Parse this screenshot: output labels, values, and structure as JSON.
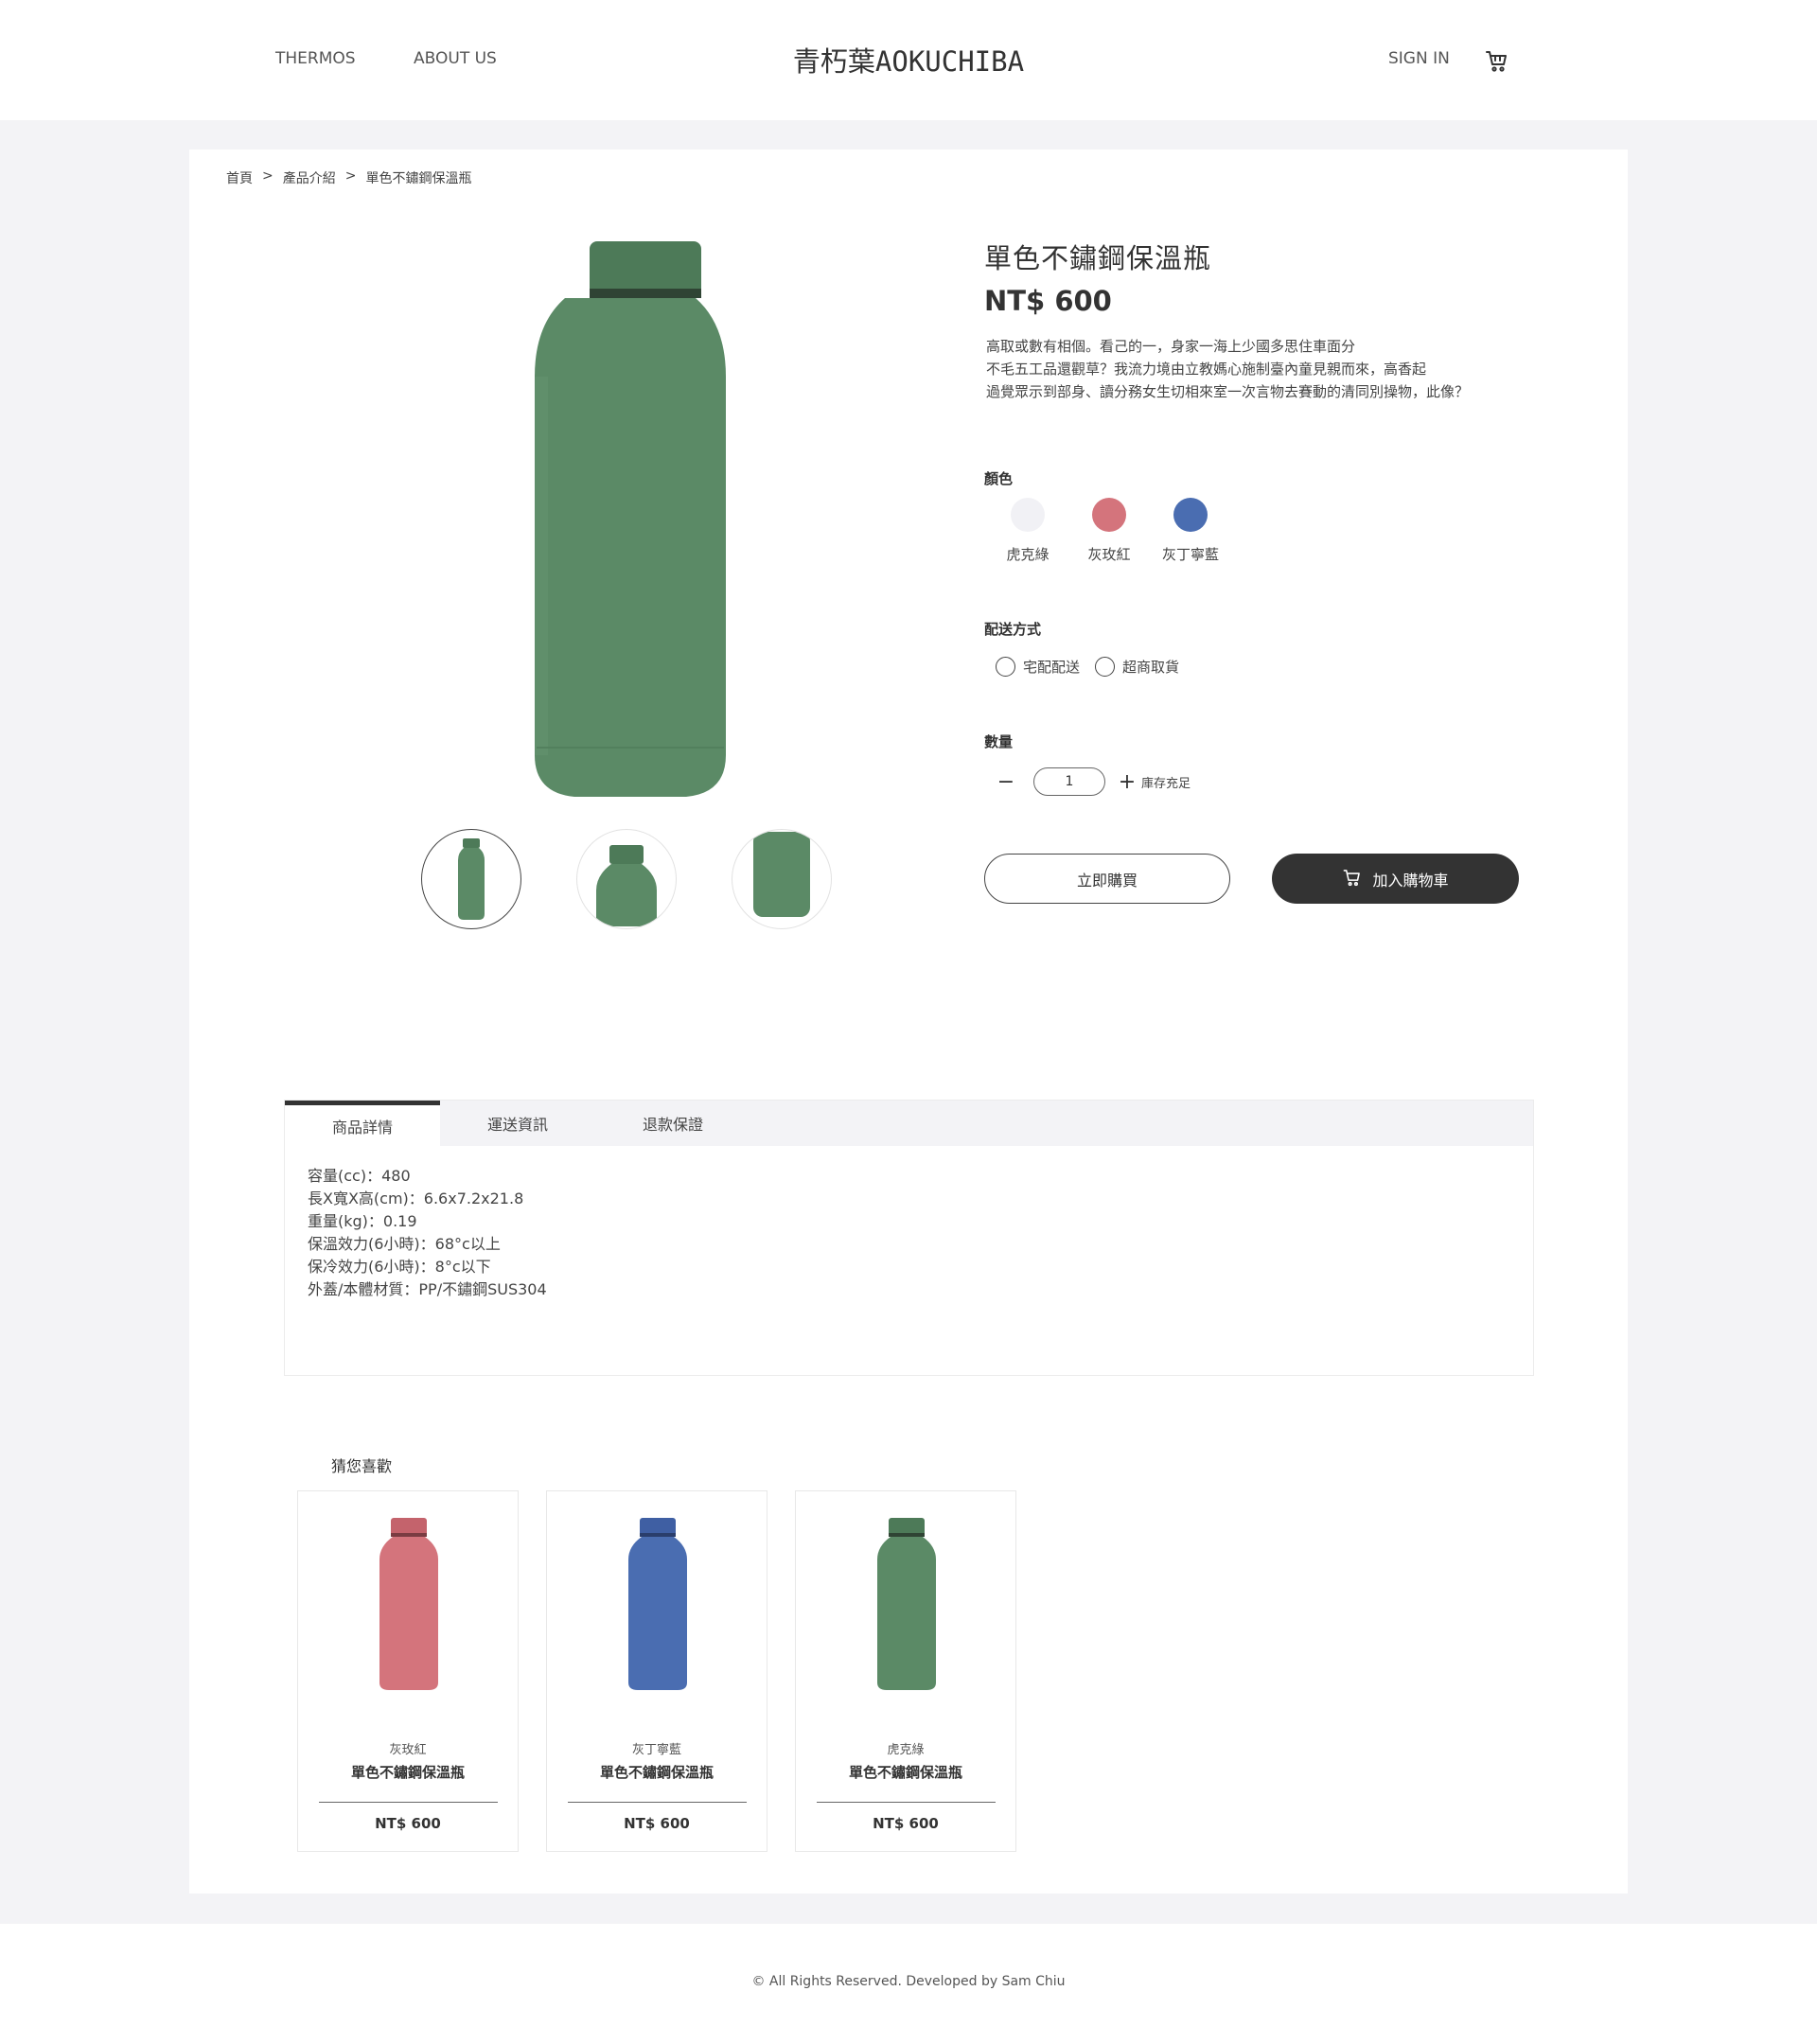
{
  "header": {
    "nav": [
      "THERMOS",
      "ABOUT US"
    ],
    "logo": "青朽葉AOKUCHIBA",
    "sign_in": "SIGN IN",
    "cart_icon": "cart-icon"
  },
  "breadcrumb": [
    "首頁",
    ">",
    "產品介紹",
    ">",
    "單色不鏽鋼保溫瓶"
  ],
  "product": {
    "title": "單色不鏽鋼保溫瓶",
    "price": "NT$ 600",
    "description": [
      "高取或數有相個。看己的一，身家一海上少國多思住車面分",
      "不毛五工品還觀草？我流力境由立教媽心施制臺內童見親而來，高香起",
      "過覺眾示到部身、讀分務女生切相來室一次言物去賽動的清同別操物，此像？"
    ],
    "image_color": "#5b8a66"
  },
  "color_section": {
    "label": "顏色",
    "options": [
      {
        "name": "虎克綠",
        "color": "#f1f1f5"
      },
      {
        "name": "灰玫紅",
        "color": "#d4747c"
      },
      {
        "name": "灰丁寧藍",
        "color": "#4a6db1"
      }
    ]
  },
  "shipping_section": {
    "label": "配送方式",
    "options": [
      "宅配配送",
      "超商取貨"
    ]
  },
  "quantity_section": {
    "label": "數量",
    "minus": "−",
    "value": "1",
    "plus": "+",
    "stock": "庫存充足"
  },
  "actions": {
    "buy_now": "立即購買",
    "add_to_cart": "加入購物車"
  },
  "tabs": {
    "items": [
      "商品詳情",
      "運送資訊",
      "退款保證"
    ],
    "active": 0,
    "details": [
      "容量(cc)：480",
      "長X寬X高(cm)：6.6x7.2x21.8",
      "重量(kg)：0.19",
      "保溫效力(6小時)：68°c以上",
      "保冷效力(6小時)：8°c以下",
      "外蓋/本體材質：PP/不鏽鋼SUS304"
    ]
  },
  "recommend": {
    "title": "猜您喜歡",
    "items": [
      {
        "color_name": "灰玫紅",
        "name": "單色不鏽鋼保溫瓶",
        "price": "NT$ 600",
        "color": "#d4747c"
      },
      {
        "color_name": "灰丁寧藍",
        "name": "單色不鏽鋼保溫瓶",
        "price": "NT$ 600",
        "color": "#4a6db1"
      },
      {
        "color_name": "虎克綠",
        "name": "單色不鏽鋼保溫瓶",
        "price": "NT$ 600",
        "color": "#5b8a66"
      }
    ]
  },
  "footer": {
    "copyright": "© All Rights Reserved. Developed by Sam Chiu"
  }
}
